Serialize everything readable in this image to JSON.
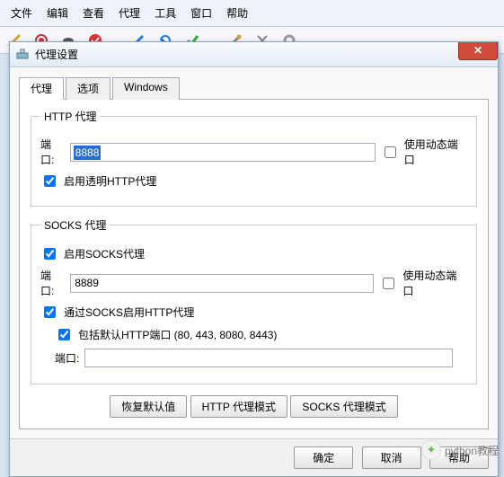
{
  "menu": {
    "items": [
      "文件",
      "编辑",
      "查看",
      "代理",
      "工具",
      "窗口",
      "帮助"
    ]
  },
  "toolbar_icons": [
    "broom",
    "record",
    "turtle",
    "check-red",
    "pencil",
    "refresh",
    "check-green",
    "wrench",
    "tools",
    "gear"
  ],
  "dialog": {
    "title": "代理设置",
    "tabs": [
      "代理",
      "选项",
      "Windows"
    ],
    "http": {
      "legend": "HTTP 代理",
      "port_label": "端口:",
      "port_value": "8888",
      "dynamic_port": "使用动态端口",
      "dynamic_port_checked": false,
      "transparent": "启用透明HTTP代理",
      "transparent_checked": true
    },
    "socks": {
      "legend": "SOCKS 代理",
      "enable": "启用SOCKS代理",
      "enable_checked": true,
      "port_label": "端口:",
      "port_value": "8889",
      "dynamic_port": "使用动态端口",
      "dynamic_port_checked": false,
      "http_via_socks": "通过SOCKS启用HTTP代理",
      "http_via_socks_checked": true,
      "include_default": "包括默认HTTP端口 (80, 443, 8080, 8443)",
      "include_default_checked": true,
      "port3_label": "端口:",
      "port3_value": ""
    },
    "buttons": {
      "restore": "恢复默认值",
      "http_mode": "HTTP 代理模式",
      "socks_mode": "SOCKS 代理模式"
    },
    "footer": {
      "ok": "确定",
      "cancel": "取消",
      "help": "帮助"
    }
  },
  "watermark": "python教程"
}
